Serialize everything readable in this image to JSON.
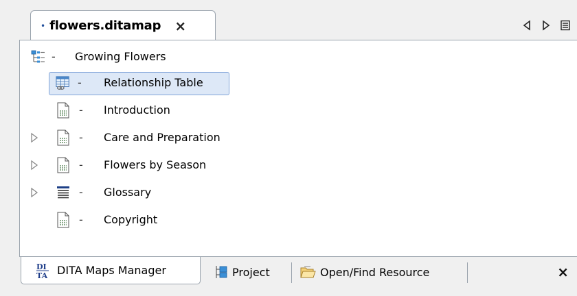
{
  "editor": {
    "tab": {
      "dot": "•",
      "title": "flowers.ditamap",
      "close": "×"
    },
    "nav": {
      "back_icon": "triangle-left-icon",
      "forward_icon": "triangle-right-icon",
      "menu_icon": "list-menu-icon"
    }
  },
  "tree": {
    "root": {
      "label": "Growing Flowers",
      "icon": "map-tree-icon"
    },
    "items": [
      {
        "label": "Relationship Table",
        "icon": "reltable-icon",
        "expandable": false,
        "selected": true
      },
      {
        "label": "Introduction",
        "icon": "topic-icon",
        "expandable": false,
        "selected": false
      },
      {
        "label": "Care and Preparation",
        "icon": "topic-icon",
        "expandable": true,
        "selected": false
      },
      {
        "label": "Flowers by Season",
        "icon": "topic-icon",
        "expandable": true,
        "selected": false
      },
      {
        "label": "Glossary",
        "icon": "glossary-icon",
        "expandable": true,
        "selected": false
      },
      {
        "label": "Copyright",
        "icon": "topic-icon",
        "expandable": false,
        "selected": false
      }
    ],
    "dash": "-"
  },
  "bottom_tabs": [
    {
      "label": "DITA Maps Manager",
      "icon": "dita-icon",
      "active": true
    },
    {
      "label": "Project",
      "icon": "project-icon",
      "active": false
    },
    {
      "label": "Open/Find Resource",
      "icon": "folder-open-icon",
      "active": false
    }
  ],
  "bottom_close": "×",
  "colors": {
    "selection_fill": "#dde8f7",
    "selection_border": "#7fa3d8",
    "tab_border": "#9aa3ad",
    "chrome": "#f0f0f0",
    "dita_icon_text": "#1f3e8a"
  }
}
